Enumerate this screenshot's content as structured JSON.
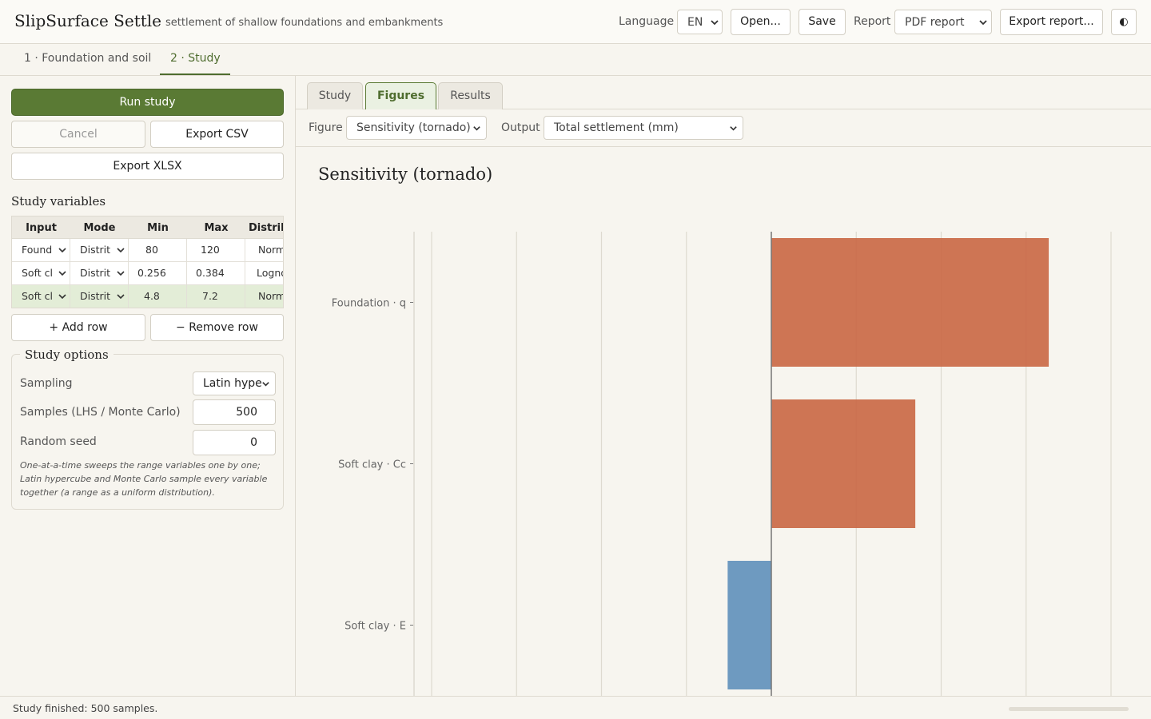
{
  "header": {
    "app_title": "SlipSurface Settle",
    "app_subtitle": "settlement of shallow foundations and embankments",
    "language_label": "Language",
    "language_value": "EN",
    "open_label": "Open...",
    "save_label": "Save",
    "report_label": "Report",
    "report_value": "PDF report",
    "export_report_label": "Export report...",
    "theme_toggle_glyph": "◐"
  },
  "steps": [
    {
      "label": "1 · Foundation and soil",
      "active": false
    },
    {
      "label": "2 · Study",
      "active": true
    }
  ],
  "left": {
    "run_label": "Run study",
    "cancel_label": "Cancel",
    "export_csv_label": "Export CSV",
    "export_xlsx_label": "Export XLSX",
    "variables_heading": "Study variables",
    "table": {
      "headers": [
        "Input",
        "Mode",
        "Min",
        "Max",
        "Distrib"
      ],
      "rows": [
        {
          "input": "Found",
          "mode": "Distrit",
          "min": "80",
          "max": "120",
          "dist": "Norm",
          "selected": false
        },
        {
          "input": "Soft cl",
          "mode": "Distrit",
          "min": "0.256",
          "max": "0.384",
          "dist": "Logno",
          "selected": false
        },
        {
          "input": "Soft cl",
          "mode": "Distrit",
          "min": "4.8",
          "max": "7.2",
          "dist": "Norm",
          "selected": true
        }
      ]
    },
    "add_row_label": "+ Add row",
    "remove_row_label": "− Remove row",
    "options": {
      "legend": "Study options",
      "sampling_label": "Sampling",
      "sampling_value": "Latin hype",
      "samples_label": "Samples (LHS / Monte Carlo)",
      "samples_value": "500",
      "seed_label": "Random seed",
      "seed_value": "0",
      "note": "One-at-a-time sweeps the range variables one by one; Latin hypercube and Monte Carlo sample every variable together (a range as a uniform distribution)."
    }
  },
  "right": {
    "tabs": [
      {
        "label": "Study",
        "active": false
      },
      {
        "label": "Figures",
        "active": true
      },
      {
        "label": "Results",
        "active": false
      }
    ],
    "figure_label": "Figure",
    "figure_value": "Sensitivity (tornado)",
    "output_label": "Output",
    "output_value": "Total settlement (mm)"
  },
  "chart_data": {
    "type": "bar",
    "orientation": "horizontal",
    "title": "Sensitivity (tornado)",
    "categories": [
      "Foundation · q",
      "Soft clay · Cc",
      "Soft clay · E"
    ],
    "values": [
      3.43,
      1.78,
      -0.54
    ],
    "xlim": [
      -4.2,
      4.2
    ],
    "grid": true,
    "colors": {
      "positive": "#c8633f",
      "negative": "#5b8db9"
    }
  },
  "status": {
    "text": "Study finished: 500 samples.",
    "progress": 1.0
  }
}
